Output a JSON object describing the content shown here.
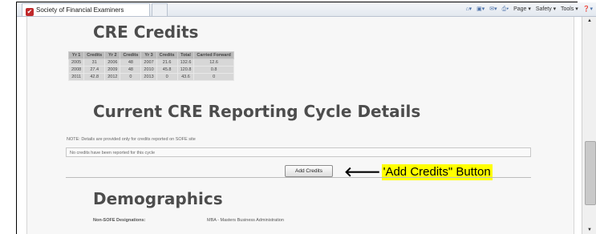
{
  "browser": {
    "tab_title": "Society of Financial Examiners",
    "favicon_glyph": "✔",
    "commands": [
      "Page ▾",
      "Safety ▾",
      "Tools ▾"
    ],
    "command_icons": [
      "home-icon",
      "feeds-icon",
      "mail-icon",
      "print-icon",
      "help-icon"
    ]
  },
  "page": {
    "cre_credits_title": "CRE Credits",
    "table": {
      "headers": [
        "Yr 1",
        "Credits",
        "Yr 2",
        "Credits",
        "Yr 3",
        "Credits",
        "Total",
        "Carried Forward"
      ],
      "rows": [
        [
          "2005",
          "31",
          "2006",
          "48",
          "2007",
          "21.6",
          "132.6",
          "12.6"
        ],
        [
          "2008",
          "27.4",
          "2009",
          "48",
          "2010",
          "45.8",
          "120.8",
          "0.8"
        ],
        [
          "2011",
          "42.8",
          "2012",
          "0",
          "2013",
          "0",
          "43.6",
          "0"
        ]
      ]
    },
    "cycle_title": "Current CRE Reporting Cycle Details",
    "cycle_note": "NOTE: Details are provided only for credits reported on SOFE site",
    "cycle_empty": "No credits have been reported for this cycle",
    "add_credits_label": "Add Credits",
    "callout_arrow": "🡐",
    "callout_text": "'Add Credits\" Button",
    "demographics_title": "Demographics",
    "demographics": {
      "label": "Non-SOFE Designations:",
      "value": "MBA - Masters Business Administration"
    }
  },
  "colors": {
    "callout_highlight": "#ffff00",
    "heading": "#4d4d4d",
    "table_header": "#b9b9b9",
    "table_cell": "#d7d7d7"
  }
}
